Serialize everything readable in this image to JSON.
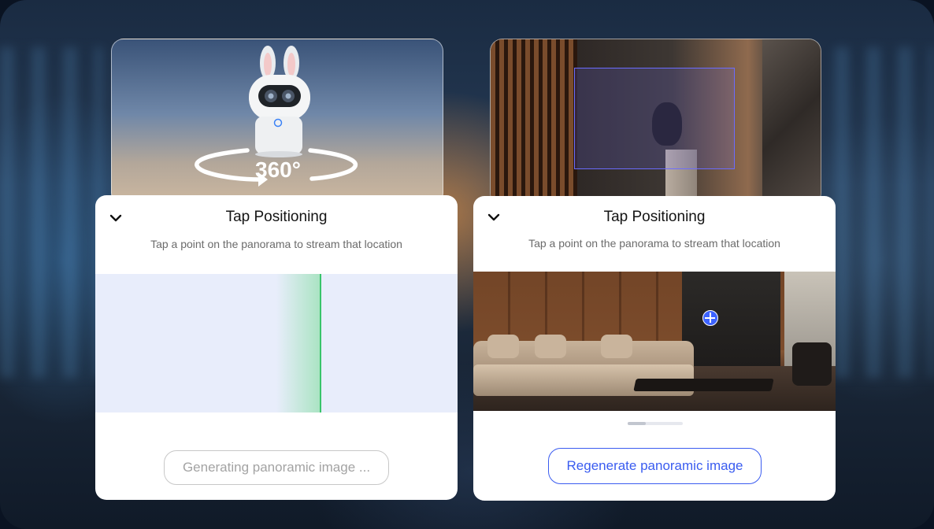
{
  "left_panel": {
    "title": "Tap Positioning",
    "subtitle": "Tap a point on the panorama to stream that location",
    "button_label": "Generating panoramic image ..."
  },
  "right_panel": {
    "title": "Tap Positioning",
    "subtitle": "Tap a point on the panorama to stream that location",
    "button_label": "Regenerate panoramic image"
  },
  "camera_preview": {
    "rotation_label": "360°"
  },
  "colors": {
    "accent": "#3a5cf0",
    "scan_line": "#39c46a",
    "disabled_text": "#a3a3a3",
    "selection_box": "#6b6cff"
  },
  "icons": {
    "collapse": "chevron-down-icon",
    "target": "crosshair-icon",
    "rotation": "rotate-arrow-icon"
  }
}
